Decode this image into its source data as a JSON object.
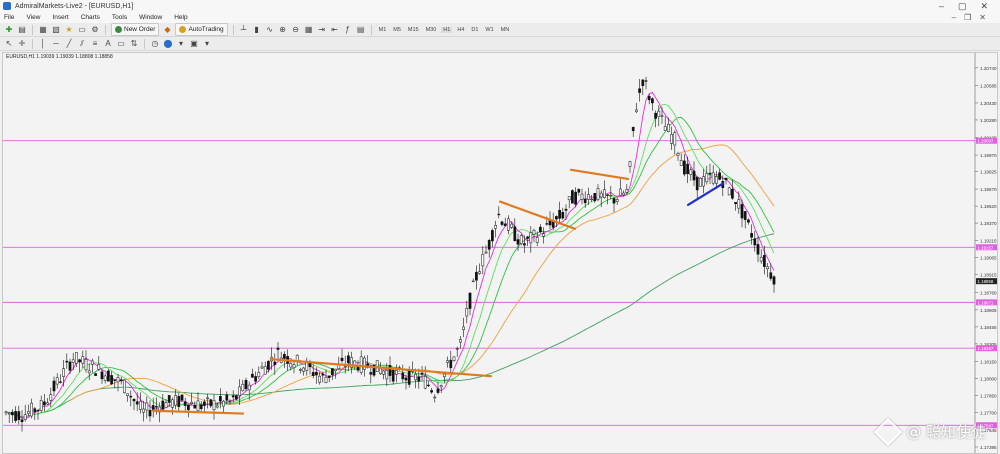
{
  "window": {
    "title": "AdmiralMarkets-Live2 - [EURUSD,H1]"
  },
  "menu": [
    "File",
    "View",
    "Insert",
    "Charts",
    "Tools",
    "Window",
    "Help"
  ],
  "toolbar": {
    "new_order_label": "New Order",
    "auto_trading_label": "AutoTrading",
    "timeframes": [
      "M1",
      "M5",
      "M15",
      "M30",
      "H1",
      "H4",
      "D1",
      "W1",
      "MN"
    ],
    "active_timeframe": "H1"
  },
  "chart": {
    "info_label": "EURUSD,H1  1.19039 1.19039 1.18808 1.18858",
    "price_ticks": [
      "1.20740",
      "1.20585",
      "1.20430",
      "1.20280",
      "1.20125",
      "1.19970",
      "1.19825",
      "1.19670",
      "1.19520",
      "1.19370",
      "1.19215",
      "1.19065",
      "1.18915",
      "1.18760",
      "1.18605",
      "1.18455",
      "1.18305",
      "1.18150",
      "1.18000",
      "1.17850",
      "1.17700",
      "1.17545",
      "1.17395"
    ],
    "current_price": "1.18858",
    "hline_labels": [
      "1.20097",
      "1.19157",
      "1.18671",
      "1.18267",
      "1.17587"
    ],
    "colors": {
      "hline": "#e060e0",
      "trend": "#e07a20",
      "trend_blue": "#2030d0",
      "ma_fast": "#e030e0",
      "ma_orange": "#f0a040",
      "ma_green": "#30c040",
      "ma_slow": "#40a060"
    }
  },
  "watermark": {
    "text": "@ 聪知使徒"
  }
}
